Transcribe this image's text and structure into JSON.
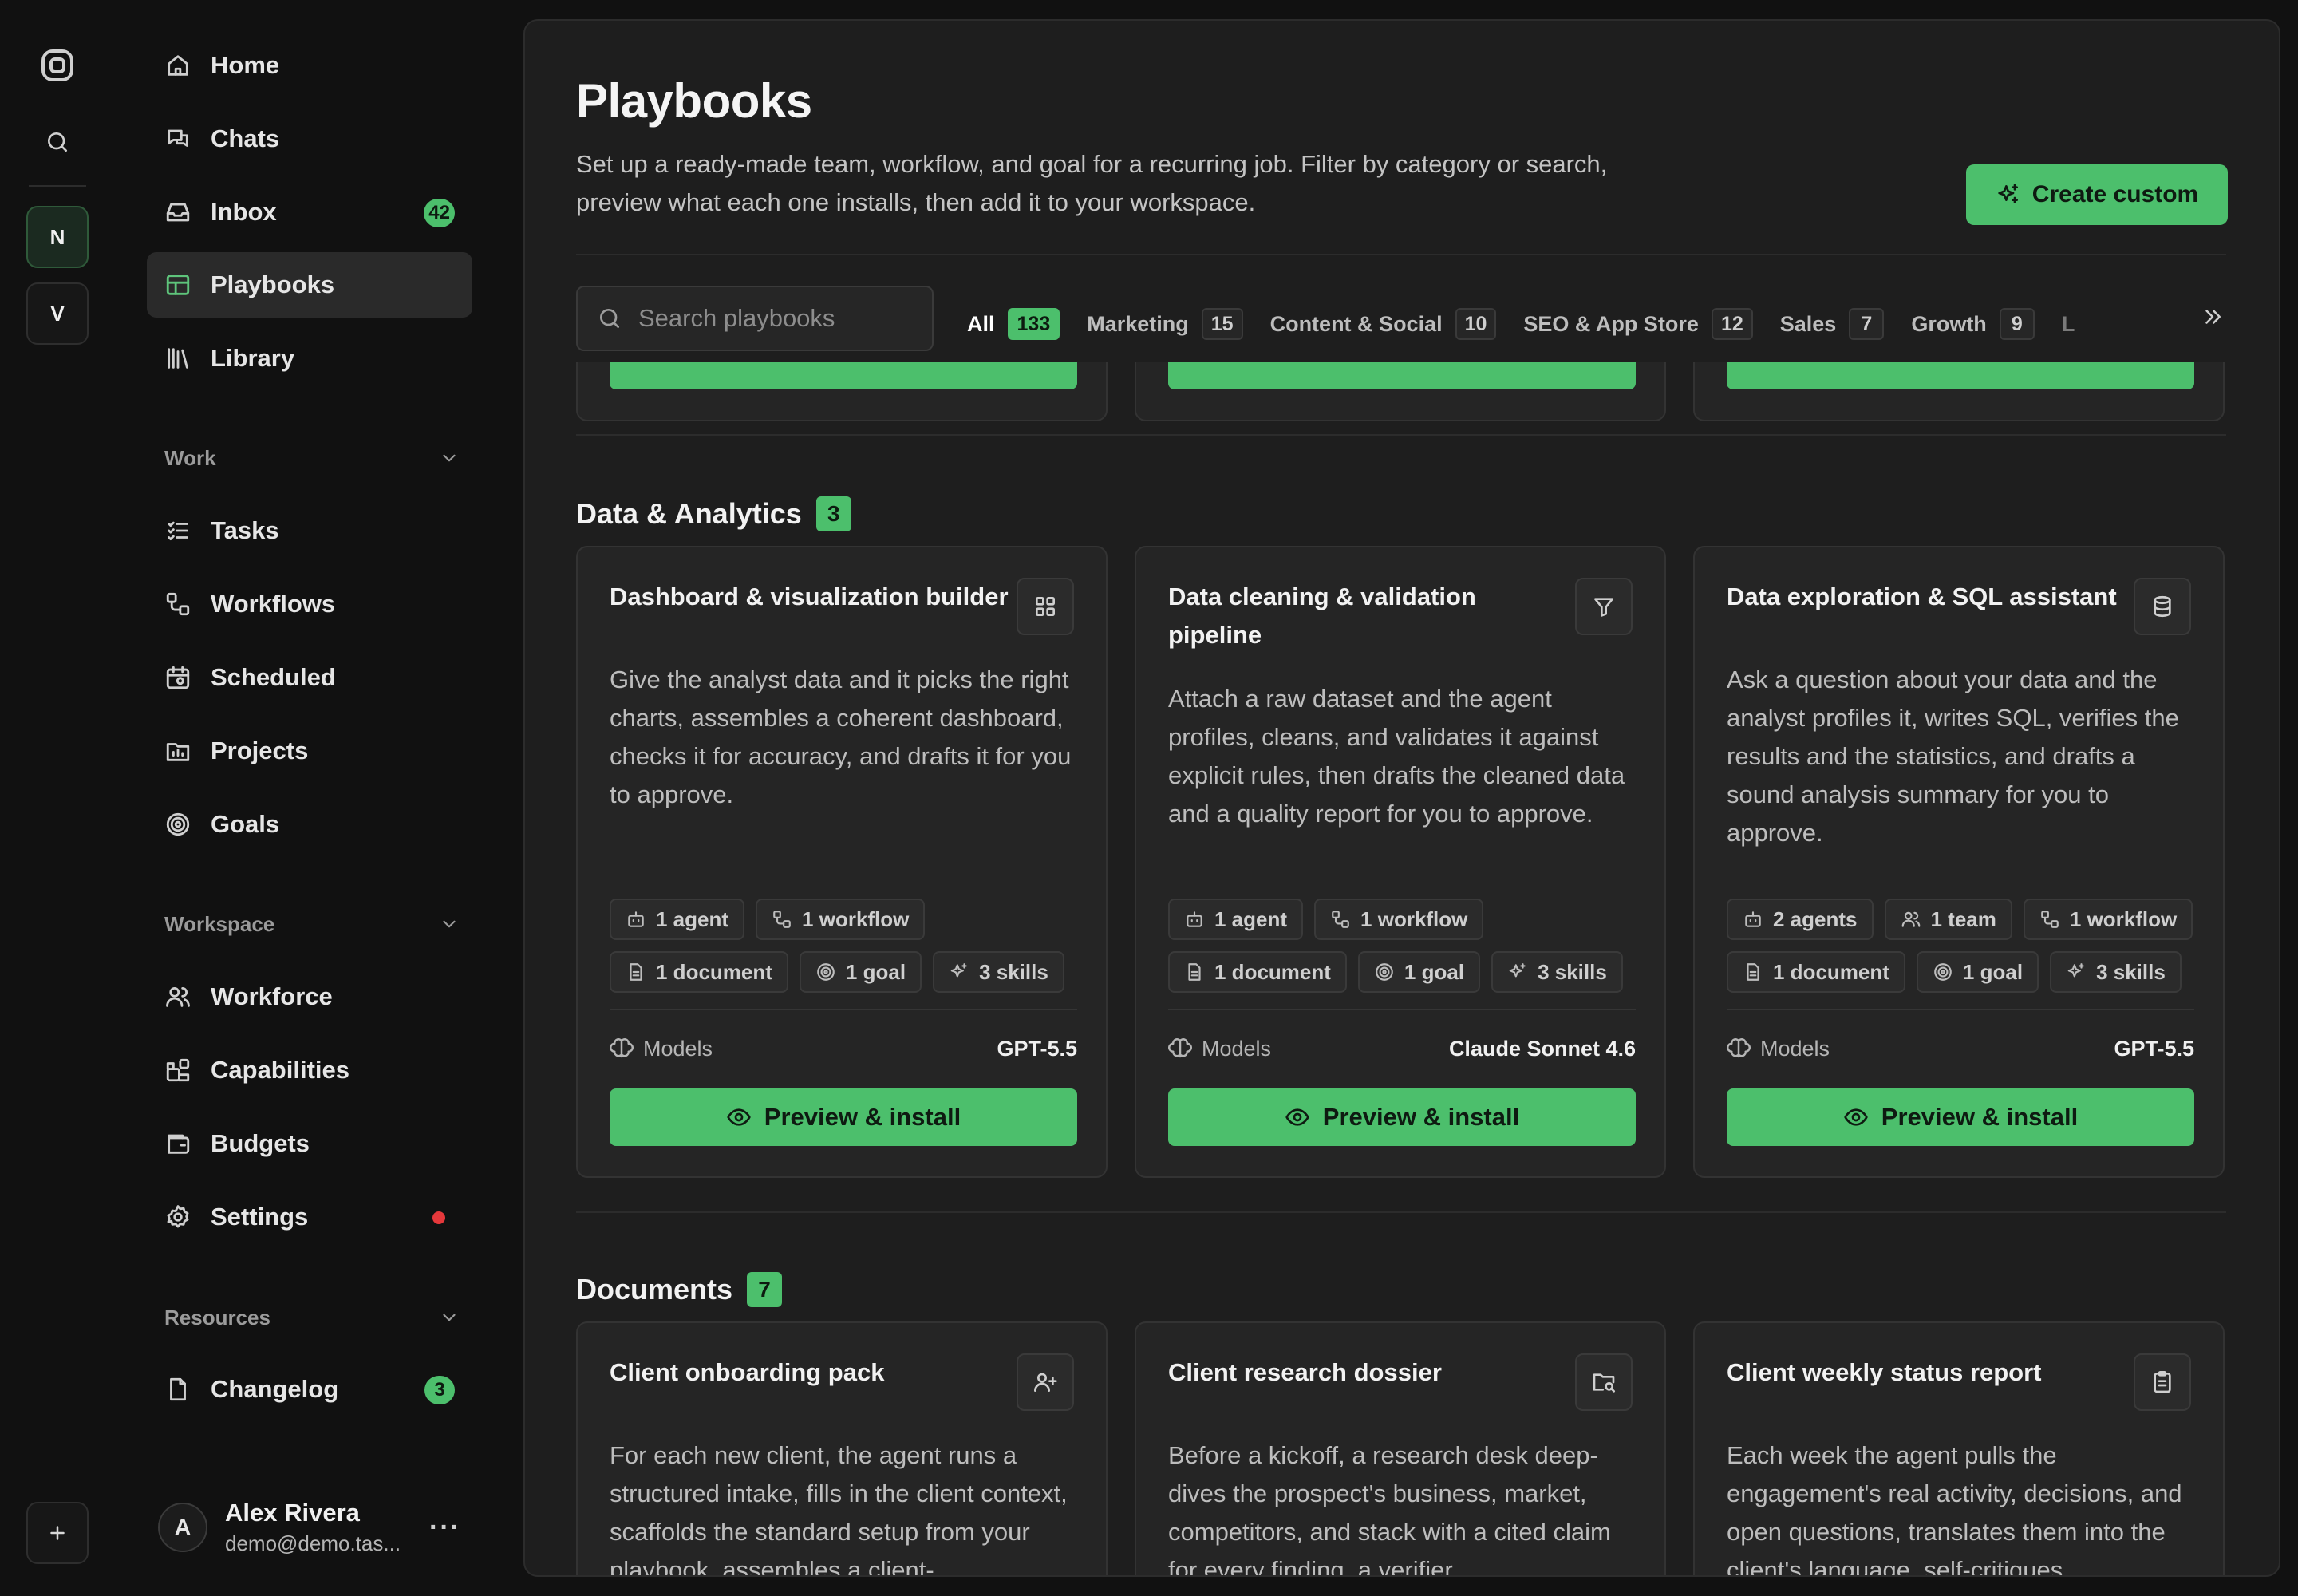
{
  "rail": {
    "workspaces": [
      "N",
      "V"
    ]
  },
  "sidebar": {
    "primary": [
      {
        "label": "Home",
        "icon": "home-icon"
      },
      {
        "label": "Chats",
        "icon": "chats-icon"
      },
      {
        "label": "Inbox",
        "icon": "inbox-icon",
        "badge": "42"
      },
      {
        "label": "Playbooks",
        "icon": "playbooks-icon",
        "active": true
      },
      {
        "label": "Library",
        "icon": "library-icon"
      }
    ],
    "work": {
      "title": "Work",
      "items": [
        {
          "label": "Tasks",
          "icon": "tasks-icon"
        },
        {
          "label": "Workflows",
          "icon": "workflows-icon"
        },
        {
          "label": "Scheduled",
          "icon": "calendar-icon"
        },
        {
          "label": "Projects",
          "icon": "projects-icon"
        },
        {
          "label": "Goals",
          "icon": "target-icon"
        }
      ]
    },
    "workspace": {
      "title": "Workspace",
      "items": [
        {
          "label": "Workforce",
          "icon": "users-icon"
        },
        {
          "label": "Capabilities",
          "icon": "capabilities-icon"
        },
        {
          "label": "Budgets",
          "icon": "wallet-icon"
        },
        {
          "label": "Settings",
          "icon": "gear-icon",
          "dot": true
        }
      ]
    },
    "resources": {
      "title": "Resources",
      "items": [
        {
          "label": "Changelog",
          "icon": "document-icon",
          "badge": "3"
        }
      ]
    },
    "user": {
      "initial": "A",
      "name": "Alex Rivera",
      "email": "demo@demo.tas..."
    }
  },
  "main": {
    "title": "Playbooks",
    "description": "Set up a ready-made team, workflow, and goal for a recurring job. Filter by category or search, preview what each one installs, then add it to your workspace.",
    "create_label": "Create custom",
    "search_placeholder": "Search playbooks",
    "tabs": [
      {
        "label": "All",
        "count": "133",
        "active": true
      },
      {
        "label": "Marketing",
        "count": "15"
      },
      {
        "label": "Content & Social",
        "count": "10"
      },
      {
        "label": "SEO & App Store",
        "count": "12"
      },
      {
        "label": "Sales",
        "count": "7"
      },
      {
        "label": "Growth",
        "count": "9"
      }
    ],
    "tab_overflow": "L",
    "models_label": "Models",
    "install_label": "Preview & install",
    "sections": [
      {
        "title": "Data & Analytics",
        "count": "3",
        "cards": [
          {
            "title": "Dashboard & visualization builder",
            "icon": "layout-grid-icon",
            "description": "Give the analyst data and it picks the right charts, assembles a coherent dashboard, checks it for accuracy, and drafts it for you to approve.",
            "chips": [
              "1 agent",
              "1 workflow",
              "1 document",
              "1 goal",
              "3 skills"
            ],
            "model": "GPT-5.5"
          },
          {
            "title": "Data cleaning & validation pipeline",
            "icon": "filter-icon",
            "description": "Attach a raw dataset and the agent profiles, cleans, and validates it against explicit rules, then drafts the cleaned data and a quality report for you to approve.",
            "chips": [
              "1 agent",
              "1 workflow",
              "1 document",
              "1 goal",
              "3 skills"
            ],
            "model": "Claude Sonnet 4.6"
          },
          {
            "title": "Data exploration & SQL assistant",
            "icon": "database-icon",
            "description": "Ask a question about your data and the analyst profiles it, writes SQL, verifies the results and the statistics, and drafts a sound analysis summary for you to approve.",
            "chips": [
              "2 agents",
              "1 team",
              "1 workflow",
              "1 document",
              "1 goal",
              "3 skills"
            ],
            "model": "GPT-5.5"
          }
        ]
      },
      {
        "title": "Documents",
        "count": "7",
        "cards": [
          {
            "title": "Client onboarding pack",
            "icon": "user-plus-icon",
            "description": "For each new client, the agent runs a structured intake, fills in the client context, scaffolds the standard setup from your playbook, assembles a client-"
          },
          {
            "title": "Client research dossier",
            "icon": "folder-search-icon",
            "description": "Before a kickoff, a research desk deep-dives the prospect's business, market, competitors, and stack with a cited claim for every finding, a verifier"
          },
          {
            "title": "Client weekly status report",
            "icon": "clipboard-icon",
            "description": "Each week the agent pulls the engagement's real activity, decisions, and open questions, translates them into the client's language, self-critiques"
          }
        ]
      }
    ],
    "colors": {
      "accent": "#4cbf6c",
      "panel": "#1e1e1e",
      "card": "#252525",
      "alert": "#e5383b"
    }
  }
}
